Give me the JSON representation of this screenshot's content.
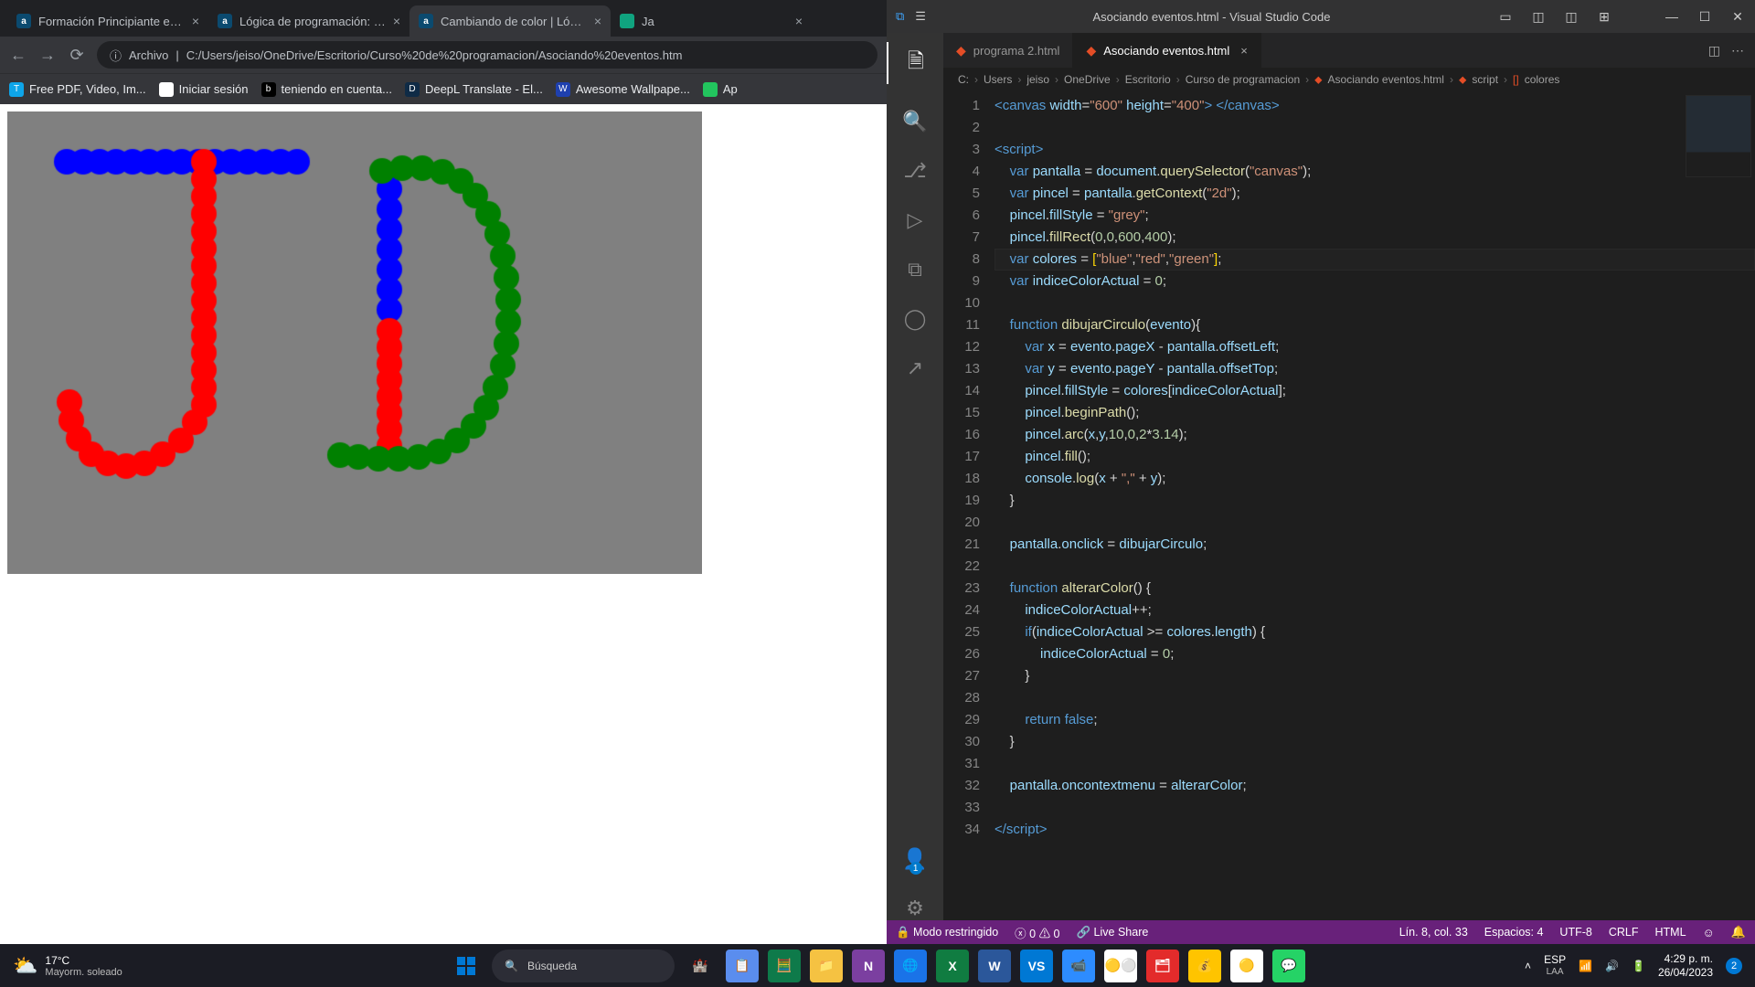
{
  "chrome": {
    "tabs": [
      {
        "icon": "a",
        "iconClass": "",
        "title": "Formación Principiante en Progra"
      },
      {
        "icon": "a",
        "iconClass": "",
        "title": "Lógica de programación: Practic"
      },
      {
        "icon": "a",
        "iconClass": "",
        "title": "Cambiando de color | Lógica de p"
      },
      {
        "icon": "",
        "iconClass": "green",
        "title": "Ja"
      }
    ],
    "nav": {
      "back": "←",
      "forward": "→",
      "reload": "⟳"
    },
    "addr": {
      "scheme_icon": "ⓘ",
      "scheme": "Archivo",
      "sep": "|",
      "url": "C:/Users/jeiso/OneDrive/Escritorio/Curso%20de%20programacion/Asociando%20eventos.htm"
    },
    "bookmarks": [
      {
        "color": "#0ea5e9",
        "icon": "T",
        "label": "Free PDF, Video, Im..."
      },
      {
        "color": "#ffffff",
        "icon": "",
        "label": "Iniciar sesión"
      },
      {
        "color": "#000000",
        "icon": "b",
        "label": "teniendo en cuenta..."
      },
      {
        "color": "#0f2b46",
        "icon": "D",
        "label": "DeepL Translate - El..."
      },
      {
        "color": "#1e40af",
        "icon": "W",
        "label": "Awesome Wallpape..."
      },
      {
        "color": "#22c55e",
        "icon": "",
        "label": "Ap"
      }
    ]
  },
  "vscode": {
    "title": "Asociando eventos.html - Visual Studio Code",
    "menuIcon": "☰",
    "layoutIcons": [
      "▭",
      "◫",
      "◫",
      "⊞"
    ],
    "winButtons": [
      "—",
      "☐",
      "✕"
    ],
    "tabs": [
      {
        "name": "programa 2.html",
        "active": false
      },
      {
        "name": "Asociando eventos.html",
        "active": true
      }
    ],
    "breadcrumb": [
      "C:",
      "Users",
      "jeiso",
      "OneDrive",
      "Escritorio",
      "Curso de programacion",
      "Asociando eventos.html",
      "script",
      "colores"
    ],
    "breadcrumbIcons": {
      "6": "⬥",
      "7": "⬥",
      "8": "[]"
    },
    "code": [
      [
        [
          "tag",
          "<canvas "
        ],
        [
          "attr",
          "width"
        ],
        [
          "op",
          "="
        ],
        [
          "str",
          "\"600\""
        ],
        [
          "op",
          " "
        ],
        [
          "attr",
          "height"
        ],
        [
          "op",
          "="
        ],
        [
          "str",
          "\"400\""
        ],
        [
          "tag",
          "> </canvas>"
        ]
      ],
      [],
      [
        [
          "tag",
          "<script"
        ],
        [
          "tag",
          ">"
        ]
      ],
      [
        [
          "op",
          "    "
        ],
        [
          "kw",
          "var"
        ],
        [
          "op",
          " "
        ],
        [
          "id",
          "pantalla"
        ],
        [
          "op",
          " = "
        ],
        [
          "id",
          "document"
        ],
        [
          "op",
          "."
        ],
        [
          "fn",
          "querySelector"
        ],
        [
          "op",
          "("
        ],
        [
          "str",
          "\"canvas\""
        ],
        [
          "op",
          ");"
        ]
      ],
      [
        [
          "op",
          "    "
        ],
        [
          "kw",
          "var"
        ],
        [
          "op",
          " "
        ],
        [
          "id",
          "pincel"
        ],
        [
          "op",
          " = "
        ],
        [
          "id",
          "pantalla"
        ],
        [
          "op",
          "."
        ],
        [
          "fn",
          "getContext"
        ],
        [
          "op",
          "("
        ],
        [
          "str",
          "\"2d\""
        ],
        [
          "op",
          ");"
        ]
      ],
      [
        [
          "op",
          "    "
        ],
        [
          "id",
          "pincel"
        ],
        [
          "op",
          "."
        ],
        [
          "id",
          "fillStyle"
        ],
        [
          "op",
          " = "
        ],
        [
          "str",
          "\"grey\""
        ],
        [
          "op",
          ";"
        ]
      ],
      [
        [
          "op",
          "    "
        ],
        [
          "id",
          "pincel"
        ],
        [
          "op",
          "."
        ],
        [
          "fn",
          "fillRect"
        ],
        [
          "op",
          "("
        ],
        [
          "num",
          "0"
        ],
        [
          "op",
          ","
        ],
        [
          "num",
          "0"
        ],
        [
          "op",
          ","
        ],
        [
          "num",
          "600"
        ],
        [
          "op",
          ","
        ],
        [
          "num",
          "400"
        ],
        [
          "op",
          ");"
        ]
      ],
      [
        [
          "op",
          "    "
        ],
        [
          "kw",
          "var"
        ],
        [
          "op",
          " "
        ],
        [
          "id",
          "colores"
        ],
        [
          "op",
          " = "
        ],
        [
          "br",
          "["
        ],
        [
          "str",
          "\"blue\""
        ],
        [
          "op",
          ","
        ],
        [
          "str",
          "\"red\""
        ],
        [
          "op",
          ","
        ],
        [
          "str",
          "\"green\""
        ],
        [
          "br",
          "]"
        ],
        [
          "op",
          ";"
        ]
      ],
      [
        [
          "op",
          "    "
        ],
        [
          "kw",
          "var"
        ],
        [
          "op",
          " "
        ],
        [
          "id",
          "indiceColorActual"
        ],
        [
          "op",
          " = "
        ],
        [
          "num",
          "0"
        ],
        [
          "op",
          ";"
        ]
      ],
      [],
      [
        [
          "op",
          "    "
        ],
        [
          "kw",
          "function"
        ],
        [
          "op",
          " "
        ],
        [
          "fn",
          "dibujarCirculo"
        ],
        [
          "op",
          "("
        ],
        [
          "id",
          "evento"
        ],
        [
          "op",
          "){"
        ]
      ],
      [
        [
          "op",
          "        "
        ],
        [
          "kw",
          "var"
        ],
        [
          "op",
          " "
        ],
        [
          "id",
          "x"
        ],
        [
          "op",
          " = "
        ],
        [
          "id",
          "evento"
        ],
        [
          "op",
          "."
        ],
        [
          "id",
          "pageX"
        ],
        [
          "op",
          " - "
        ],
        [
          "id",
          "pantalla"
        ],
        [
          "op",
          "."
        ],
        [
          "id",
          "offsetLeft"
        ],
        [
          "op",
          ";"
        ]
      ],
      [
        [
          "op",
          "        "
        ],
        [
          "kw",
          "var"
        ],
        [
          "op",
          " "
        ],
        [
          "id",
          "y"
        ],
        [
          "op",
          " = "
        ],
        [
          "id",
          "evento"
        ],
        [
          "op",
          "."
        ],
        [
          "id",
          "pageY"
        ],
        [
          "op",
          " - "
        ],
        [
          "id",
          "pantalla"
        ],
        [
          "op",
          "."
        ],
        [
          "id",
          "offsetTop"
        ],
        [
          "op",
          ";"
        ]
      ],
      [
        [
          "op",
          "        "
        ],
        [
          "id",
          "pincel"
        ],
        [
          "op",
          "."
        ],
        [
          "id",
          "fillStyle"
        ],
        [
          "op",
          " = "
        ],
        [
          "id",
          "colores"
        ],
        [
          "op",
          "["
        ],
        [
          "id",
          "indiceColorActual"
        ],
        [
          "op",
          "];"
        ]
      ],
      [
        [
          "op",
          "        "
        ],
        [
          "id",
          "pincel"
        ],
        [
          "op",
          "."
        ],
        [
          "fn",
          "beginPath"
        ],
        [
          "op",
          "();"
        ]
      ],
      [
        [
          "op",
          "        "
        ],
        [
          "id",
          "pincel"
        ],
        [
          "op",
          "."
        ],
        [
          "fn",
          "arc"
        ],
        [
          "op",
          "("
        ],
        [
          "id",
          "x"
        ],
        [
          "op",
          ","
        ],
        [
          "id",
          "y"
        ],
        [
          "op",
          ","
        ],
        [
          "num",
          "10"
        ],
        [
          "op",
          ","
        ],
        [
          "num",
          "0"
        ],
        [
          "op",
          ","
        ],
        [
          "num",
          "2"
        ],
        [
          "op",
          "*"
        ],
        [
          "num",
          "3.14"
        ],
        [
          "op",
          ");"
        ]
      ],
      [
        [
          "op",
          "        "
        ],
        [
          "id",
          "pincel"
        ],
        [
          "op",
          "."
        ],
        [
          "fn",
          "fill"
        ],
        [
          "op",
          "();"
        ]
      ],
      [
        [
          "op",
          "        "
        ],
        [
          "id",
          "console"
        ],
        [
          "op",
          "."
        ],
        [
          "fn",
          "log"
        ],
        [
          "op",
          "("
        ],
        [
          "id",
          "x"
        ],
        [
          "op",
          " + "
        ],
        [
          "str",
          "\",\""
        ],
        [
          "op",
          " + "
        ],
        [
          "id",
          "y"
        ],
        [
          "op",
          ");"
        ]
      ],
      [
        [
          "op",
          "    }"
        ]
      ],
      [],
      [
        [
          "op",
          "    "
        ],
        [
          "id",
          "pantalla"
        ],
        [
          "op",
          "."
        ],
        [
          "id",
          "onclick"
        ],
        [
          "op",
          " = "
        ],
        [
          "id",
          "dibujarCirculo"
        ],
        [
          "op",
          ";"
        ]
      ],
      [],
      [
        [
          "op",
          "    "
        ],
        [
          "kw",
          "function"
        ],
        [
          "op",
          " "
        ],
        [
          "fn",
          "alterarColor"
        ],
        [
          "op",
          "() {"
        ]
      ],
      [
        [
          "op",
          "        "
        ],
        [
          "id",
          "indiceColorActual"
        ],
        [
          "op",
          "++;"
        ]
      ],
      [
        [
          "op",
          "        "
        ],
        [
          "kw",
          "if"
        ],
        [
          "op",
          "("
        ],
        [
          "id",
          "indiceColorActual"
        ],
        [
          "op",
          " >= "
        ],
        [
          "id",
          "colores"
        ],
        [
          "op",
          "."
        ],
        [
          "id",
          "length"
        ],
        [
          "op",
          ") {"
        ]
      ],
      [
        [
          "op",
          "            "
        ],
        [
          "id",
          "indiceColorActual"
        ],
        [
          "op",
          " = "
        ],
        [
          "num",
          "0"
        ],
        [
          "op",
          ";"
        ]
      ],
      [
        [
          "op",
          "        }"
        ]
      ],
      [],
      [
        [
          "op",
          "        "
        ],
        [
          "kw",
          "return"
        ],
        [
          "op",
          " "
        ],
        [
          "bool",
          "false"
        ],
        [
          "op",
          ";"
        ]
      ],
      [
        [
          "op",
          "    }"
        ]
      ],
      [],
      [
        [
          "op",
          "    "
        ],
        [
          "id",
          "pantalla"
        ],
        [
          "op",
          "."
        ],
        [
          "id",
          "oncontextmenu"
        ],
        [
          "op",
          " = "
        ],
        [
          "id",
          "alterarColor"
        ],
        [
          "op",
          ";"
        ]
      ],
      [],
      [
        [
          "tag",
          "</script"
        ],
        [
          "tag",
          ">"
        ]
      ]
    ],
    "status": {
      "restricted": "Modo restringido",
      "errors": "0",
      "warnings": "0",
      "liveshare": "Live Share",
      "pos": "Lín. 8, col. 33",
      "spaces": "Espacios: 4",
      "encoding": "UTF-8",
      "eol": "CRLF",
      "lang": "HTML",
      "feedback": "☺",
      "bell": "🔔"
    },
    "activity": [
      "🗎",
      "🔍",
      "⎇",
      "▷",
      "⧉",
      "◯",
      "↗"
    ]
  },
  "taskbar": {
    "weather": {
      "temp": "17°C",
      "desc": "Mayorm. soleado",
      "icon": "⛅"
    },
    "search": {
      "placeholder": "Búsqueda",
      "icon": "🔍"
    },
    "apps": [
      "🪟",
      "🏰",
      "📋",
      "🧮",
      "📁",
      "N",
      "🌐",
      "X",
      "W",
      "VS",
      "📹",
      "🟡⚪",
      "🗂",
      "💰",
      "🟡",
      "💬"
    ],
    "appColors": [
      "",
      "",
      "#5a8dee",
      "#0e7a4a",
      "#f5c242",
      "#7b3fa0",
      "#1a73e8",
      "#107c41",
      "#2b579a",
      "#0078d4",
      "#2d8cff",
      "#ffffff",
      "#e32b2b",
      "#ffc400",
      "#ffffff",
      "#25d366"
    ],
    "tray": {
      "up": "˄",
      "lang1": "ESP",
      "lang2": "LAA",
      "wifi": "📶",
      "vol": "🔊",
      "bat": "🔋",
      "time": "4:29 p. m.",
      "date": "26/04/2023",
      "notif": "2"
    }
  }
}
